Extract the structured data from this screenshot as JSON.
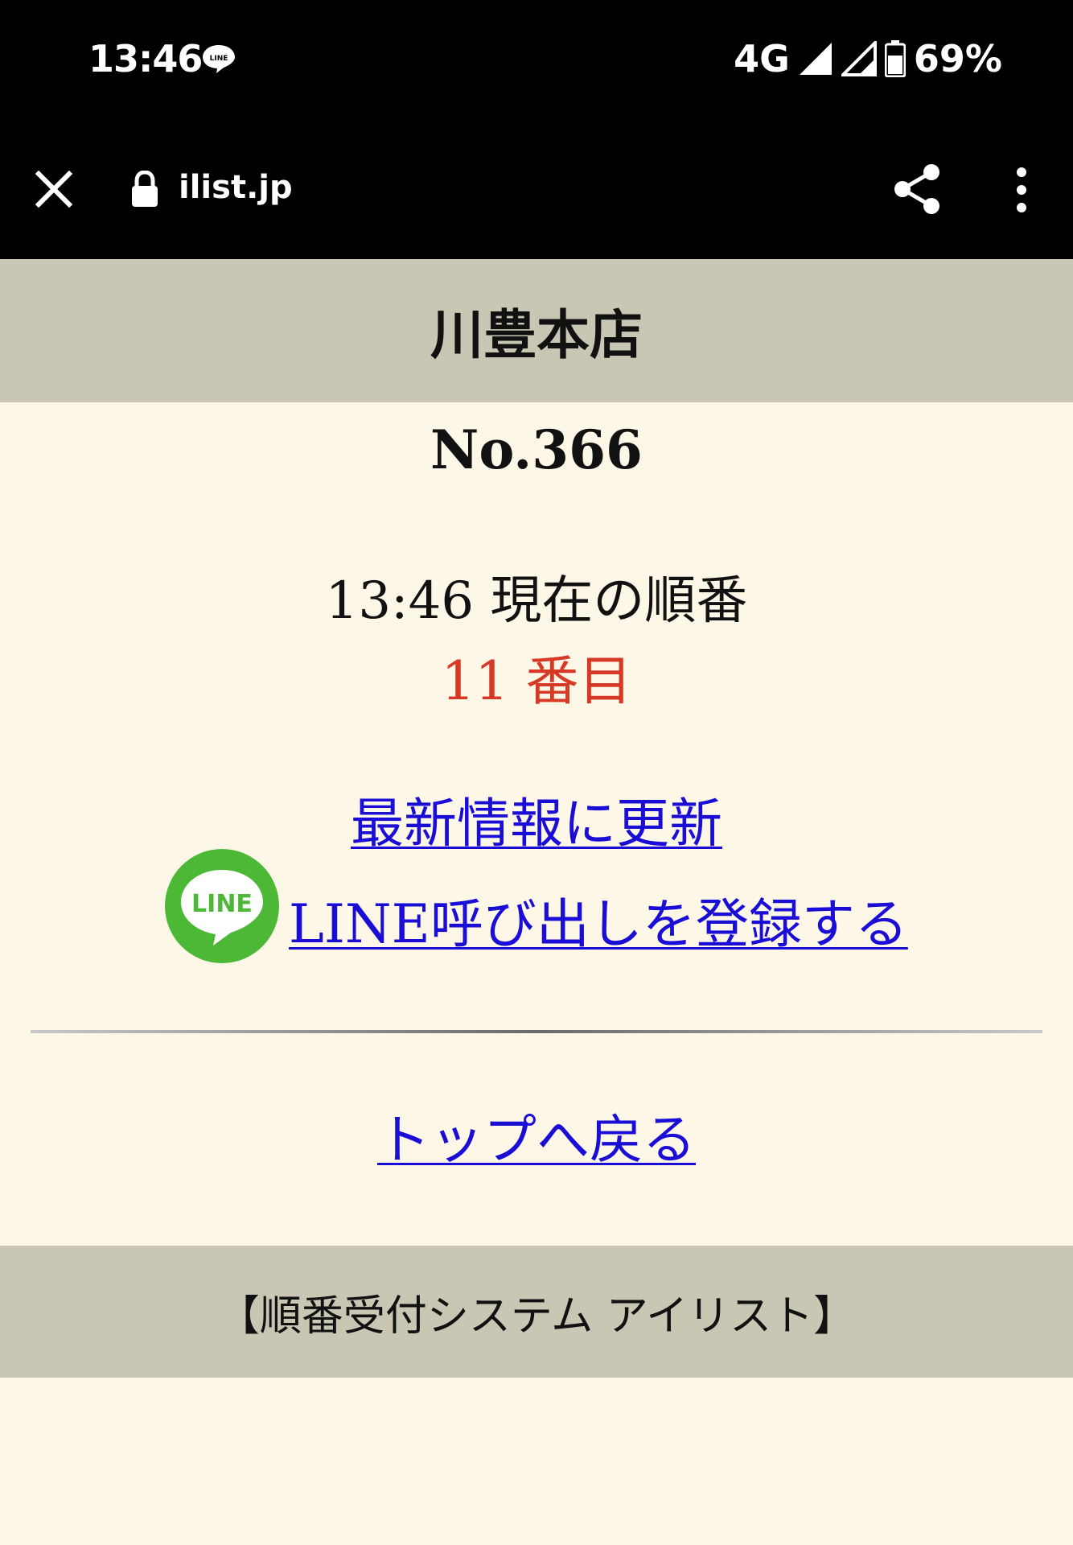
{
  "status_bar": {
    "time": "13:46",
    "network": "4G",
    "battery": "69%",
    "notification_icon": "line-notification-icon"
  },
  "browser": {
    "url": "ilist.jp",
    "icons": [
      "close-icon",
      "lock-icon",
      "share-icon",
      "more-vert-icon"
    ]
  },
  "page": {
    "shop_name": "川豊本店",
    "ticket_number": "No.366",
    "status_text": "13:46 現在の順番",
    "position_text": "11 番目",
    "refresh_link": "最新情報に更新",
    "line_register_link": "LINE呼び出しを登録する",
    "line_logo_text": "LINE",
    "top_link": "トップへ戻る",
    "footer": "【順番受付システム アイリスト】"
  },
  "colors": {
    "background": "#fdf7e8",
    "header_footer": "#c9c7b4",
    "link": "#1a0dd6",
    "position_accent": "#d63a26",
    "line_green": "#4cb836"
  }
}
